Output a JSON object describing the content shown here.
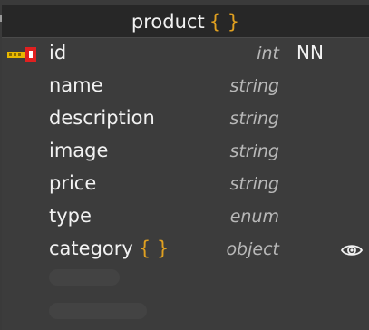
{
  "entity": {
    "name": "product",
    "braces": "{ }"
  },
  "fields": [
    {
      "name": "id",
      "type": "int",
      "flag": "NN",
      "icon": "primary-key-icon"
    },
    {
      "name": "name",
      "type": "string"
    },
    {
      "name": "description",
      "type": "string"
    },
    {
      "name": "image",
      "type": "string"
    },
    {
      "name": "price",
      "type": "string"
    },
    {
      "name": "type",
      "type": "enum"
    },
    {
      "name": "category",
      "type": "object",
      "braces": "{ }",
      "icon": "eye-icon"
    }
  ],
  "colors": {
    "background": "#3c3c3c",
    "header": "#272727",
    "text": "#f2f2f2",
    "type_text": "#b8b8b8",
    "accent": "#e0a020",
    "key_red": "#e02020",
    "key_gold": "#e8b800"
  }
}
